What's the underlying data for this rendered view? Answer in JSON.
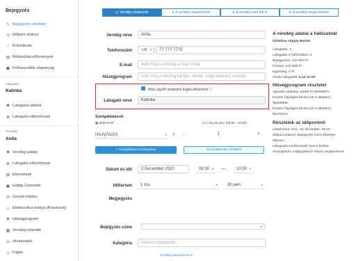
{
  "sidebar": {
    "title": "Bejegyzés",
    "items_top": [
      {
        "icon": "edit-icon",
        "label": "Bejegyzés részletei",
        "active": true
      },
      {
        "icon": "clock-icon",
        "label": "Időpont státusz"
      },
      {
        "icon": "bell-icon",
        "label": "Értesítések"
      },
      {
        "icon": "history-icon",
        "label": "Módosítási előzmények"
      },
      {
        "icon": "users-icon",
        "label": "Felhasználók alapanyag"
      }
    ],
    "visitor_section": "Látogató:",
    "visitor_name": "Katinka",
    "visitor_items": [
      {
        "icon": "person-icon",
        "label": "Látogatói adatok"
      },
      {
        "icon": "list-icon",
        "label": "Látogatói előzmények"
      }
    ],
    "guest_section": "Vendég:",
    "guest_name": "Anita",
    "guest_items": [
      {
        "icon": "person-icon",
        "label": "Vendég adatai"
      },
      {
        "icon": "list-icon",
        "label": "Látogatói előzmények"
      },
      {
        "icon": "star-icon",
        "label": "Elemzések"
      },
      {
        "icon": "gift-icon",
        "label": "Eddigi Üzenetek"
      },
      {
        "icon": "envelope-icon",
        "label": "Üzenet küldés"
      },
      {
        "icon": "card-icon",
        "label": "Elektronikus kártya (Passbook)"
      },
      {
        "icon": "tag-icon",
        "label": "Hűségprogram"
      },
      {
        "icon": "invoice-icon",
        "label": "Vendég számlák"
      },
      {
        "icon": "phone-icon",
        "label": "Hívásnapló"
      },
      {
        "icon": "file-icon",
        "label": "Fájlok"
      }
    ]
  },
  "tabs": [
    {
      "label": "Vendég várakozás",
      "selected": true
    },
    {
      "label": "A vendég megérkezett"
    },
    {
      "label": "A vendég nem jött el"
    },
    {
      "label": "A vendég megérdsdette"
    }
  ],
  "form": {
    "guest_name_label": "Vendég neve",
    "guest_name_value": "Anita",
    "phone_label": "Telefonszám",
    "phone_prefix": "+36",
    "phone_value": "77 777 7775",
    "email_label": "E-mail",
    "email_placeholder": "Add meg a vendég e-mail címét",
    "loyalty_label": "Hűségprogram",
    "loyalty_placeholder": "Add meg a vendég kártya-, bérlet- vagy utalvány számát",
    "other_checkbox": "Más ügyfél számára foglal időpontot",
    "visitor_label": "Látogató neve",
    "visitor_value": "Katinka"
  },
  "services": {
    "title": "Szolgáltatások",
    "price": "5000 HUF",
    "duration_info": "1 óra 30 perc (08:30 - 10:00)",
    "service_select": "HAJVÁGÁS",
    "qty": "1",
    "minus": "−",
    "plus": "+",
    "service_btn": "+ Szolgáltatás hozzáadása",
    "extra_btn": "Kiválasztás a listából"
  },
  "schedule": {
    "date_label": "Dátum és idő",
    "date_value": "2 December 2020",
    "time_from": "08:30",
    "dash": "—",
    "time_to": "10:00",
    "duration_label": "Időtartam",
    "hours": "1 óra",
    "minutes": "30 perc",
    "note_label": "Megjegyzés",
    "color_label": "Bejegyzés színe",
    "category_label": "Kategória",
    "category_placeholder": "Válassz kategóriát...",
    "more": "További paraméterek ▾"
  },
  "right": {
    "heading": "A vendég adatai a hálózatnál",
    "subheading": "Üzletlánc Happy Barber",
    "lines": [
      "Látogatás: 4",
      "Látogatás a hálózatban: 4",
      "Bejegyezve: 142 500 Ft",
      "Fizetve: 142 500 Ft",
      "Egyenleg: 0 Ft"
    ],
    "last_visit_label": "Utolsó látogatás:",
    "last_visit_value": "2,12 12:00",
    "loyalty_heading": "Hűségprogram részletei",
    "loyalty_lines": [
      "Ajándék utalvány 15000 Ft №099670",
      "Kreatív hajvágás bérlet (10+2 alkalom)",
      "№600899",
      "Kreatív hajvágás bérlet (10+2 alkalom)",
      "№470413"
    ],
    "details_heading": "Részletek az időpontról",
    "details_lines": [
      "Létrehozva: Sze., 02 december, 09:23",
      "Időpont státusz: Bejegyzés nincs kifizetve",
      "teljesen",
      "Látogatási emlékeztető: Nincs küldve",
      "Visszajelzés a látogatásról: Nincs megkérdezve"
    ]
  },
  "colors": {
    "accent": "#2d7fc1",
    "highlight": "#d42b2b"
  }
}
